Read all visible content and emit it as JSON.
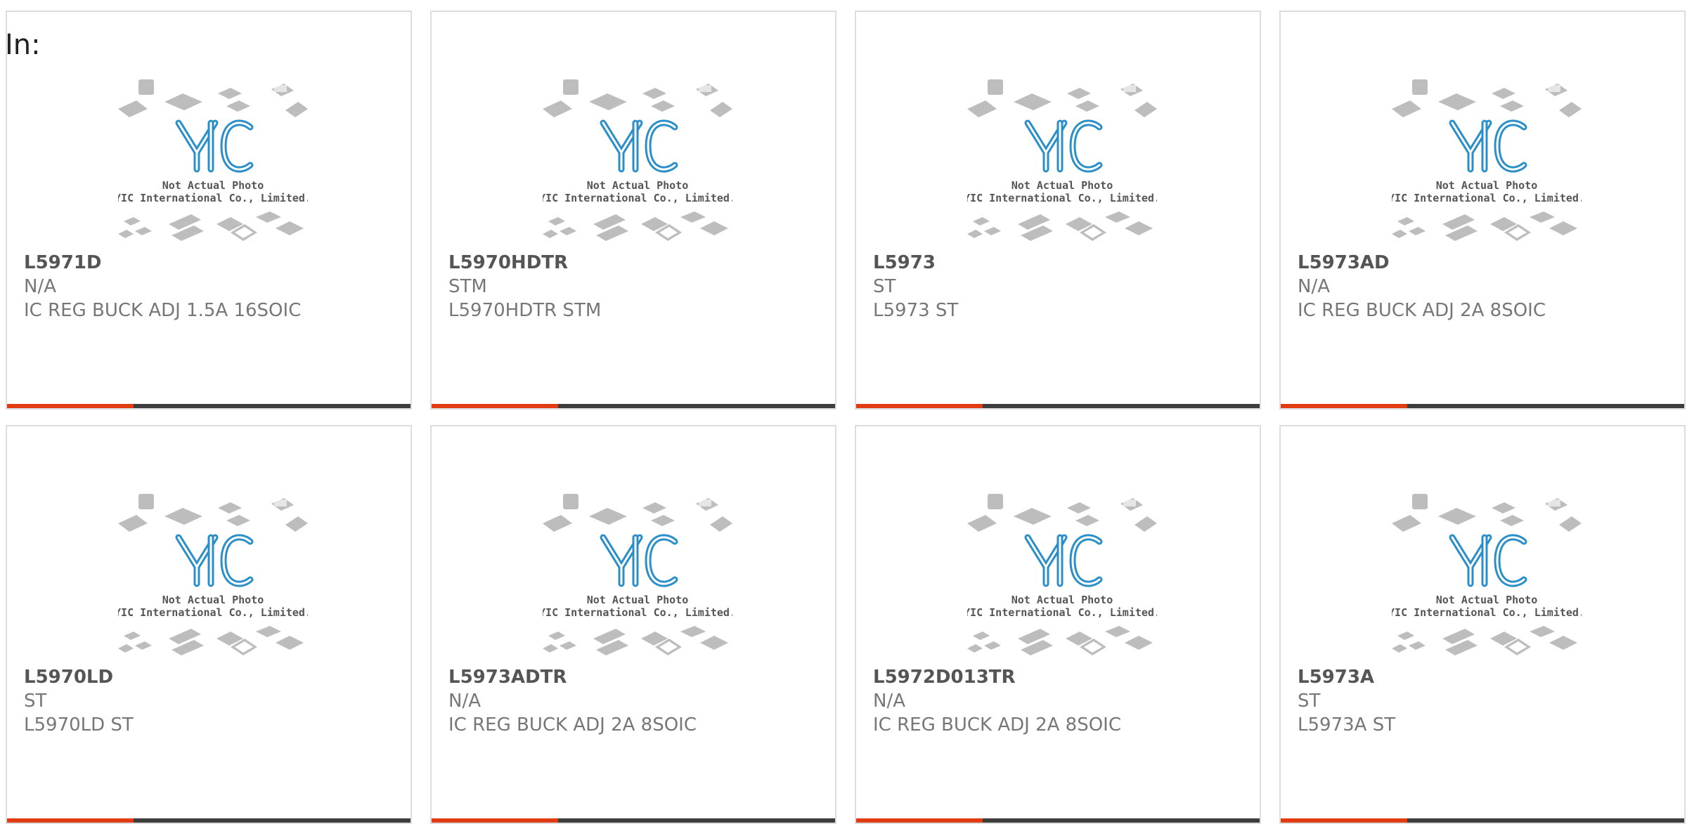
{
  "header": {
    "label": "In:"
  },
  "placeholder": {
    "logo_text": "YIC",
    "line1": "Not Actual Photo",
    "line2": "YIC International Co., Limited."
  },
  "colors": {
    "accent": "#e13b14",
    "bar": "#3d3d3d",
    "logo": "#2a8fc8"
  },
  "products": [
    {
      "part": "L5971D",
      "manufacturer": "N/A",
      "description": "IC REG BUCK ADJ 1.5A 16SOIC"
    },
    {
      "part": "L5970HDTR",
      "manufacturer": "STM",
      "description": "L5970HDTR STM"
    },
    {
      "part": "L5973",
      "manufacturer": "ST",
      "description": "L5973 ST"
    },
    {
      "part": "L5973AD",
      "manufacturer": "N/A",
      "description": "IC REG BUCK ADJ 2A 8SOIC"
    },
    {
      "part": "L5970LD",
      "manufacturer": "ST",
      "description": "L5970LD ST"
    },
    {
      "part": "L5973ADTR",
      "manufacturer": "N/A",
      "description": "IC REG BUCK ADJ 2A 8SOIC"
    },
    {
      "part": "L5972D013TR",
      "manufacturer": "N/A",
      "description": "IC REG BUCK ADJ 2A 8SOIC"
    },
    {
      "part": "L5973A",
      "manufacturer": "ST",
      "description": "L5973A ST"
    }
  ]
}
